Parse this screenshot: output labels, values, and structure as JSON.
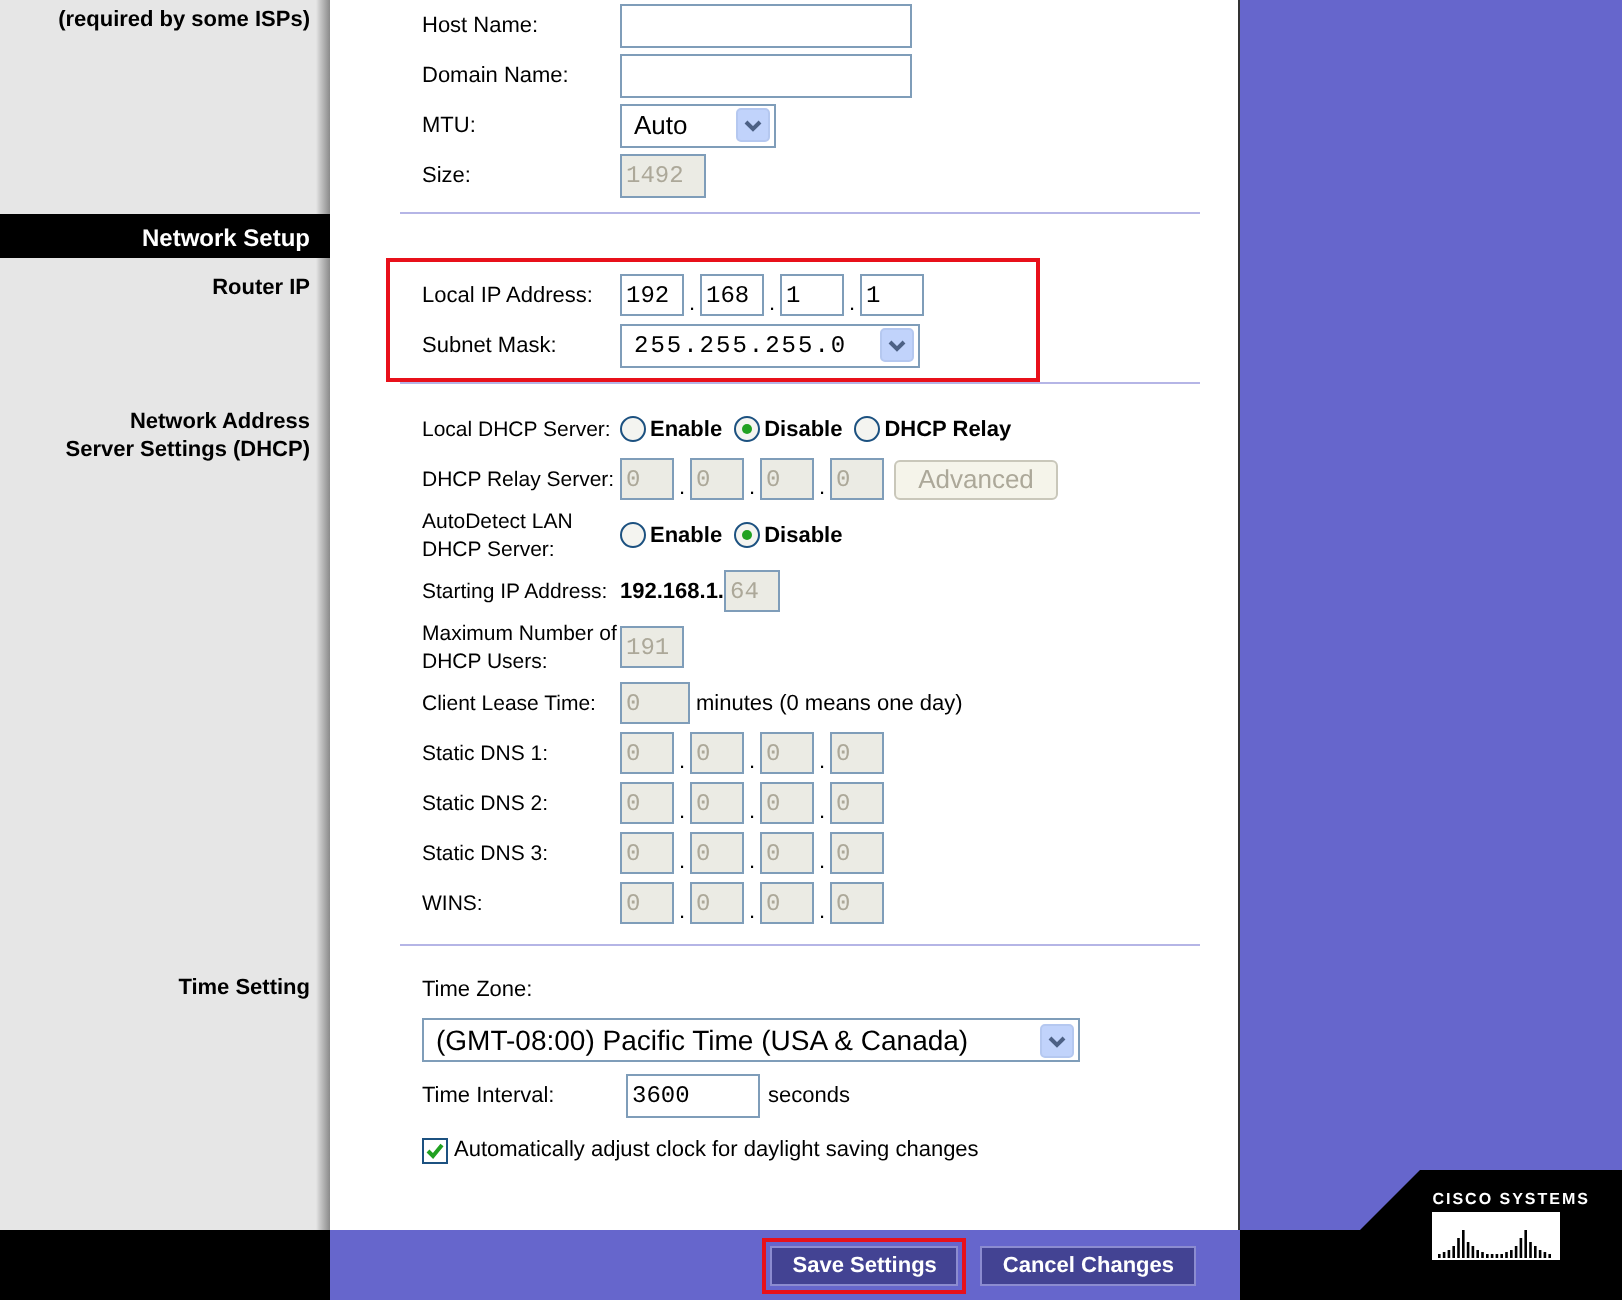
{
  "optional_settings": {
    "side_label": "(required by some ISPs)",
    "rows": [
      {
        "kind": "text",
        "label": "Host Name:"
      },
      {
        "kind": "text",
        "label": "Domain Name:"
      },
      {
        "kind": "select",
        "label": "MTU:",
        "value": "Auto"
      },
      {
        "kind": "text",
        "label": "Size:",
        "value": "1492",
        "disabled": true
      }
    ]
  },
  "network_setup": {
    "heading": "Network Setup",
    "router_ip": {
      "side_label": "Router IP",
      "highlighted": true,
      "local_ip": {
        "label": "Local IP Address:",
        "octets": [
          "192",
          "168",
          "1",
          "1"
        ],
        "separator": "."
      },
      "subnet_mask": {
        "label": "Subnet Mask:",
        "value": "255.255.255.0"
      }
    },
    "dhcp": {
      "side_label_lines": [
        "Network Address",
        "Server Settings (DHCP)"
      ],
      "rows": [
        {
          "kind": "radio",
          "label_lines": [
            "Local DHCP Server:"
          ],
          "options": [
            {
              "label": "Enable",
              "selected": false
            },
            {
              "label": "Disable",
              "selected": true
            },
            {
              "label": "DHCP Relay",
              "selected": false
            }
          ]
        },
        {
          "kind": "ip",
          "label_lines": [
            "DHCP Relay Server:"
          ],
          "octets": [
            "0",
            "0",
            "0",
            "0"
          ],
          "separator": ".",
          "disabled": true,
          "button": {
            "label": "Advanced",
            "disabled": true
          }
        },
        {
          "kind": "radio",
          "label_lines": [
            "AutoDetect LAN",
            "DHCP Server:"
          ],
          "options": [
            {
              "label": "Enable",
              "selected": false
            },
            {
              "label": "Disable",
              "selected": true
            }
          ]
        },
        {
          "kind": "prefixed",
          "label_lines": [
            "Starting IP Address:"
          ],
          "prefix": "192.168.1.",
          "value": "64",
          "disabled": true
        },
        {
          "kind": "number",
          "label_lines": [
            "Maximum Number of",
            "DHCP Users:"
          ],
          "value": "191",
          "disabled": true
        },
        {
          "kind": "number",
          "label_lines": [
            "Client Lease Time:"
          ],
          "value": "0",
          "suffix": "minutes (0 means one day)",
          "disabled": true
        },
        {
          "kind": "ip",
          "label_lines": [
            "Static DNS 1:"
          ],
          "octets": [
            "0",
            "0",
            "0",
            "0"
          ],
          "separator": ".",
          "disabled": true
        },
        {
          "kind": "ip",
          "label_lines": [
            "Static DNS 2:"
          ],
          "octets": [
            "0",
            "0",
            "0",
            "0"
          ],
          "separator": ".",
          "disabled": true
        },
        {
          "kind": "ip",
          "label_lines": [
            "Static DNS 3:"
          ],
          "octets": [
            "0",
            "0",
            "0",
            "0"
          ],
          "separator": ".",
          "disabled": true
        },
        {
          "kind": "ip",
          "label_lines": [
            "WINS:"
          ],
          "octets": [
            "0",
            "0",
            "0",
            "0"
          ],
          "separator": ".",
          "disabled": true
        }
      ]
    }
  },
  "time_setting": {
    "side_label": "Time Setting",
    "time_zone": {
      "label": "Time Zone:",
      "value": "(GMT-08:00) Pacific Time (USA & Canada)"
    },
    "interval": {
      "label": "Time Interval:",
      "value": "3600",
      "suffix": "seconds"
    },
    "daylight_saving": {
      "label": "Automatically adjust clock for daylight saving changes",
      "checked": true
    }
  },
  "footer": {
    "buttons": [
      {
        "label": "Save Settings",
        "highlighted": true
      },
      {
        "label": "Cancel Changes",
        "highlighted": false
      }
    ],
    "logo": "CISCO SYSTEMS"
  }
}
